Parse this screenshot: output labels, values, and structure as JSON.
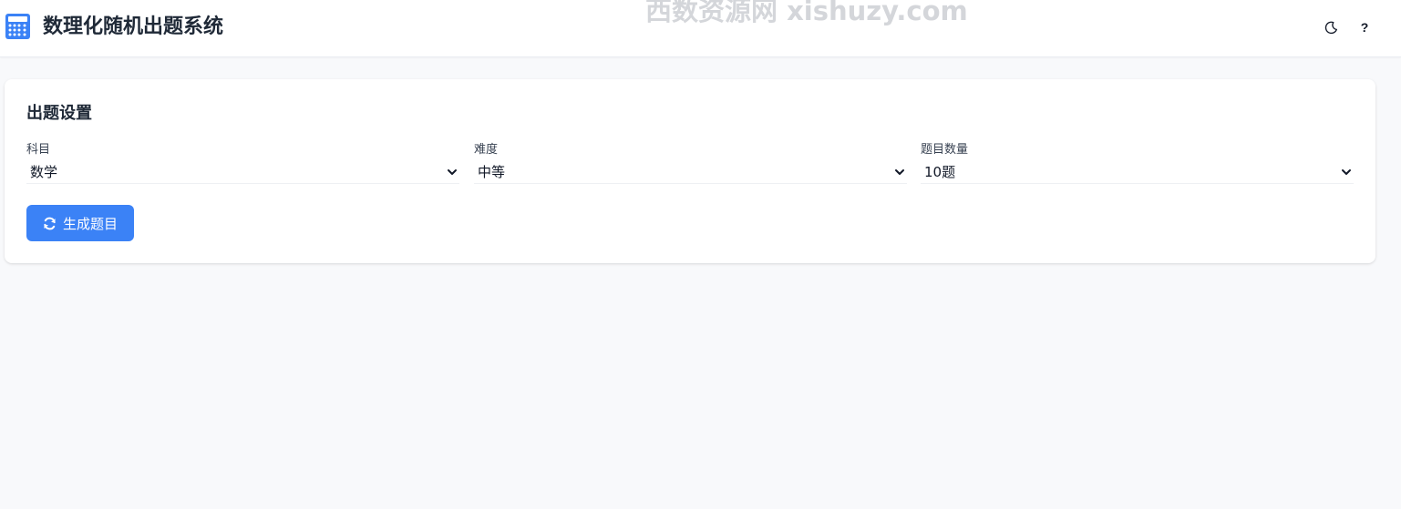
{
  "header": {
    "title": "数理化随机出题系统",
    "watermark": "西数资源网 xishuzy.com",
    "icons": {
      "logo": "calculator-icon",
      "theme": "moon-icon",
      "help": "question-icon"
    },
    "help_glyph": "?"
  },
  "settings": {
    "title": "出题设置",
    "subject": {
      "label": "科目",
      "value": "数学"
    },
    "difficulty": {
      "label": "难度",
      "value": "中等"
    },
    "count": {
      "label": "题目数量",
      "value": "10题"
    },
    "generate_label": "生成题目",
    "generate_icon": "refresh-icon"
  },
  "colors": {
    "accent": "#3b82f6",
    "background": "#f8f9fb"
  }
}
